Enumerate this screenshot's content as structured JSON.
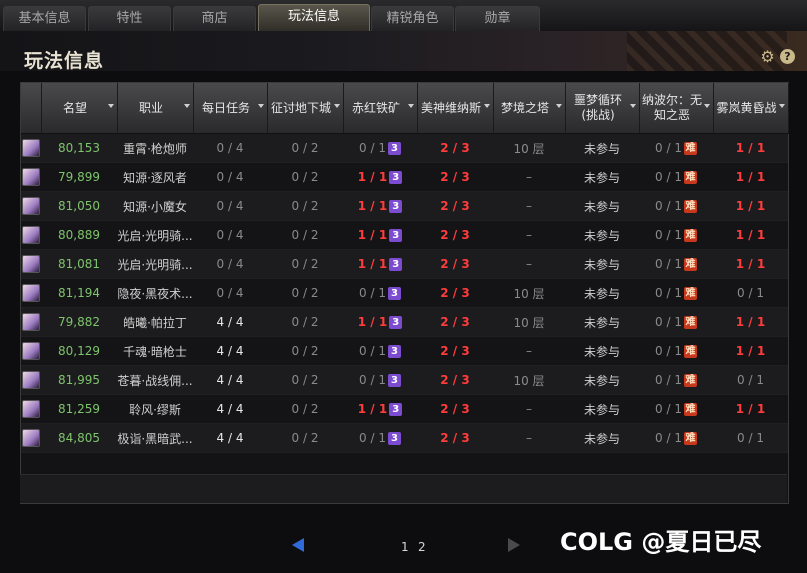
{
  "tabs": [
    {
      "label": "基本信息"
    },
    {
      "label": "特性"
    },
    {
      "label": "商店"
    },
    {
      "label": "玩法信息"
    },
    {
      "label": "精锐角色"
    },
    {
      "label": "勋章"
    }
  ],
  "page_title": "玩法信息",
  "icons": {
    "settings": "gear-icon",
    "help": "help-icon"
  },
  "help_glyph": "?",
  "columns": [
    {
      "label": "名望"
    },
    {
      "label": "职业"
    },
    {
      "label": "每日任务"
    },
    {
      "label": "征讨地下城"
    },
    {
      "label": "赤红铁矿"
    },
    {
      "label": "美神维纳斯"
    },
    {
      "label": "梦境之塔"
    },
    {
      "label": "噩梦循环(挑战)"
    },
    {
      "label": "纳波尔：无知之恶"
    },
    {
      "label": "雾岚黄昏战"
    }
  ],
  "badges": {
    "iron": "3",
    "nabol": "难"
  },
  "rows": [
    {
      "fame": "80,153",
      "job": "重霄·枪炮师",
      "daily": "0 / 4",
      "dungeon": "0 / 2",
      "iron": "0 / 1",
      "venus": "2 / 3",
      "tower": "10 层",
      "nightmare": "未参与",
      "nabol": "0 / 1",
      "mist": "1 / 1"
    },
    {
      "fame": "79,899",
      "job": "知源·逐风者",
      "daily": "0 / 4",
      "dungeon": "0 / 2",
      "iron": "1 / 1",
      "venus": "2 / 3",
      "tower": "–",
      "nightmare": "未参与",
      "nabol": "0 / 1",
      "mist": "1 / 1"
    },
    {
      "fame": "81,050",
      "job": "知源·小魔女",
      "daily": "0 / 4",
      "dungeon": "0 / 2",
      "iron": "1 / 1",
      "venus": "2 / 3",
      "tower": "–",
      "nightmare": "未参与",
      "nabol": "0 / 1",
      "mist": "1 / 1"
    },
    {
      "fame": "80,889",
      "job": "光启·光明骑...",
      "daily": "0 / 4",
      "dungeon": "0 / 2",
      "iron": "1 / 1",
      "venus": "2 / 3",
      "tower": "–",
      "nightmare": "未参与",
      "nabol": "0 / 1",
      "mist": "1 / 1"
    },
    {
      "fame": "81,081",
      "job": "光启·光明骑...",
      "daily": "0 / 4",
      "dungeon": "0 / 2",
      "iron": "1 / 1",
      "venus": "2 / 3",
      "tower": "–",
      "nightmare": "未参与",
      "nabol": "0 / 1",
      "mist": "1 / 1"
    },
    {
      "fame": "81,194",
      "job": "隐夜·黑夜术...",
      "daily": "0 / 4",
      "dungeon": "0 / 2",
      "iron": "0 / 1",
      "venus": "2 / 3",
      "tower": "10 层",
      "nightmare": "未参与",
      "nabol": "0 / 1",
      "mist": "0 / 1"
    },
    {
      "fame": "79,882",
      "job": "皓曦·帕拉丁",
      "daily": "4 / 4",
      "dungeon": "0 / 2",
      "iron": "1 / 1",
      "venus": "2 / 3",
      "tower": "10 层",
      "nightmare": "未参与",
      "nabol": "0 / 1",
      "mist": "1 / 1"
    },
    {
      "fame": "80,129",
      "job": "千魂·暗枪士",
      "daily": "4 / 4",
      "dungeon": "0 / 2",
      "iron": "0 / 1",
      "venus": "2 / 3",
      "tower": "–",
      "nightmare": "未参与",
      "nabol": "0 / 1",
      "mist": "1 / 1"
    },
    {
      "fame": "81,995",
      "job": "苍暮·战线佣...",
      "daily": "4 / 4",
      "dungeon": "0 / 2",
      "iron": "0 / 1",
      "venus": "2 / 3",
      "tower": "10 层",
      "nightmare": "未参与",
      "nabol": "0 / 1",
      "mist": "0 / 1"
    },
    {
      "fame": "81,259",
      "job": "聆风·缪斯",
      "daily": "4 / 4",
      "dungeon": "0 / 2",
      "iron": "1 / 1",
      "venus": "2 / 3",
      "tower": "–",
      "nightmare": "未参与",
      "nabol": "0 / 1",
      "mist": "1 / 1"
    },
    {
      "fame": "84,805",
      "job": "极诣·黑暗武...",
      "daily": "4 / 4",
      "dungeon": "0 / 2",
      "iron": "0 / 1",
      "venus": "2 / 3",
      "tower": "–",
      "nightmare": "未参与",
      "nabol": "0 / 1",
      "mist": "0 / 1"
    }
  ],
  "pagination": {
    "page1": "1",
    "page2": "2"
  },
  "watermark": "COLG @夏日已尽"
}
